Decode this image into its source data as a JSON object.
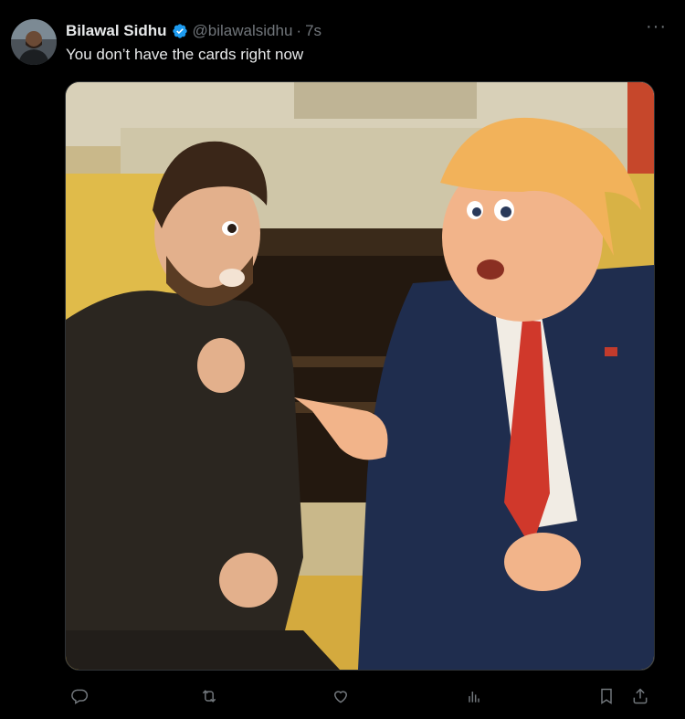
{
  "tweet": {
    "author_name": "Bilawal Sidhu",
    "handle": "@bilawalsidhu",
    "separator": "·",
    "time": "7s",
    "text": "You don’t have the cards right now",
    "more_label": "···"
  },
  "icons": {
    "verified": "verified-badge-icon",
    "reply": "reply-icon",
    "retweet": "retweet-icon",
    "like": "heart-icon",
    "views": "views-icon",
    "bookmark": "bookmark-icon",
    "share": "share-icon"
  },
  "colors": {
    "background": "#000000",
    "text_primary": "#e7e9ea",
    "text_secondary": "#71767b",
    "verified_blue": "#1d9bf0"
  }
}
